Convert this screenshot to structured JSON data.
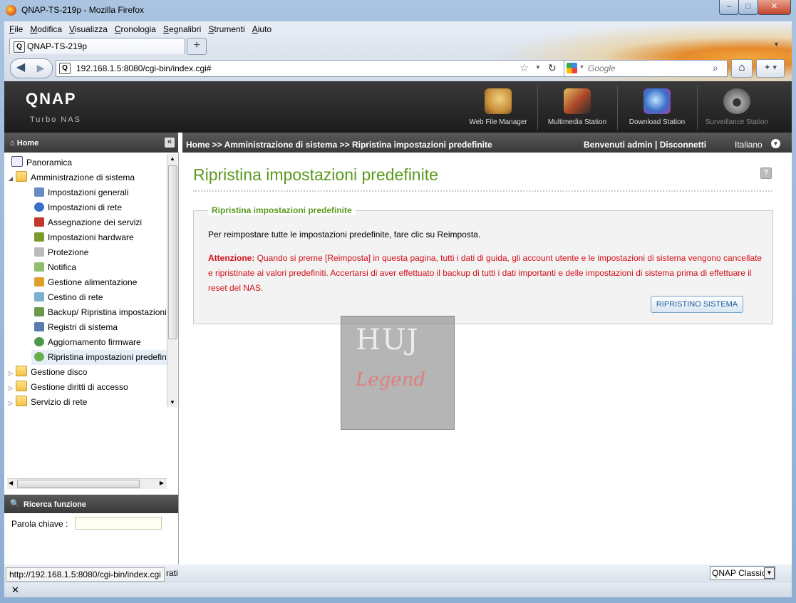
{
  "window": {
    "title": "QNAP-TS-219p - Mozilla Firefox",
    "min": "–",
    "max": "□",
    "close": "✕"
  },
  "menu": [
    "File",
    "Modifica",
    "Visualizza",
    "Cronologia",
    "Segnalibri",
    "Strumenti",
    "Aiuto"
  ],
  "tab": {
    "label": "QNAP-TS-219p",
    "new_tab": "+"
  },
  "nav": {
    "url": "192.168.1.5:8080/cgi-bin/index.cgi#",
    "search_placeholder": "Google"
  },
  "qnap": {
    "logo": "QNAP",
    "subtitle": "Turbo NAS",
    "apps": [
      {
        "label": "Web File Manager",
        "color": "#c98e3a"
      },
      {
        "label": "Multimedia Station",
        "color": "#b04a2a"
      },
      {
        "label": "Download Station",
        "color": "#3a6fc9"
      },
      {
        "label": "Surveillance Station",
        "color": "#6a6a6a"
      }
    ],
    "sidebar_header": "Home",
    "breadcrumb": "Home >> Amministrazione di sistema >> Ripristina impostazioni predefinite",
    "welcome": "Benvenuti admin  |  Disconnetti",
    "language": "Italiano"
  },
  "tree": [
    {
      "label": "Panoramica",
      "level": 0,
      "folder": false
    },
    {
      "label": "Amministrazione di sistema",
      "level": 0,
      "folder": true,
      "expanded": true
    },
    {
      "label": "Impostazioni generali",
      "level": 1
    },
    {
      "label": "Impostazioni di rete",
      "level": 1
    },
    {
      "label": "Assegnazione dei servizi",
      "level": 1
    },
    {
      "label": "Impostazioni hardware",
      "level": 1
    },
    {
      "label": "Protezione",
      "level": 1
    },
    {
      "label": "Notifica",
      "level": 1
    },
    {
      "label": "Gestione alimentazione",
      "level": 1
    },
    {
      "label": "Cestino di rete",
      "level": 1
    },
    {
      "label": "Backup/ Ripristina impostazioni",
      "level": 1
    },
    {
      "label": "Registri di sistema",
      "level": 1
    },
    {
      "label": "Aggiornamento firmware",
      "level": 1
    },
    {
      "label": "Ripristina impostazioni predefinite",
      "level": 1,
      "selected": true
    },
    {
      "label": "Gestione disco",
      "level": 0,
      "folder": true
    },
    {
      "label": "Gestione diritti di accesso",
      "level": 0,
      "folder": true
    },
    {
      "label": "Servizio di rete",
      "level": 0,
      "folder": true
    }
  ],
  "search_panel": {
    "title": "Ricerca funzione",
    "keyword_label": "Parola chiave :"
  },
  "page": {
    "title": "Ripristina impostazioni predefinite",
    "section_title": "Ripristina impostazioni predefinite",
    "instruction": "Per reimpostare tutte le impostazioni predefinite, fare clic su Reimposta.",
    "warning_label": "Attenzione:",
    "warning_text": " Quando si preme [Reimposta] in questa pagina, tutti i dati di guida, gli account utente e le impostazioni di sistema vengono cancellate e ripristinate ai valori predefiniti. Accertarsi di aver effettuato il backup di tutti i dati importanti e delle impostazioni di sistema prima di effettuare il reset del NAS.",
    "reset_button": "RIPRISTINO SISTEMA"
  },
  "watermark": {
    "line1": "HUJ",
    "line2": "Legend"
  },
  "statusbar": {
    "url": "http://192.168.1.5:8080/cgi-bin/index.cgi",
    "trail": "rati",
    "theme": "QNAP Classic"
  }
}
